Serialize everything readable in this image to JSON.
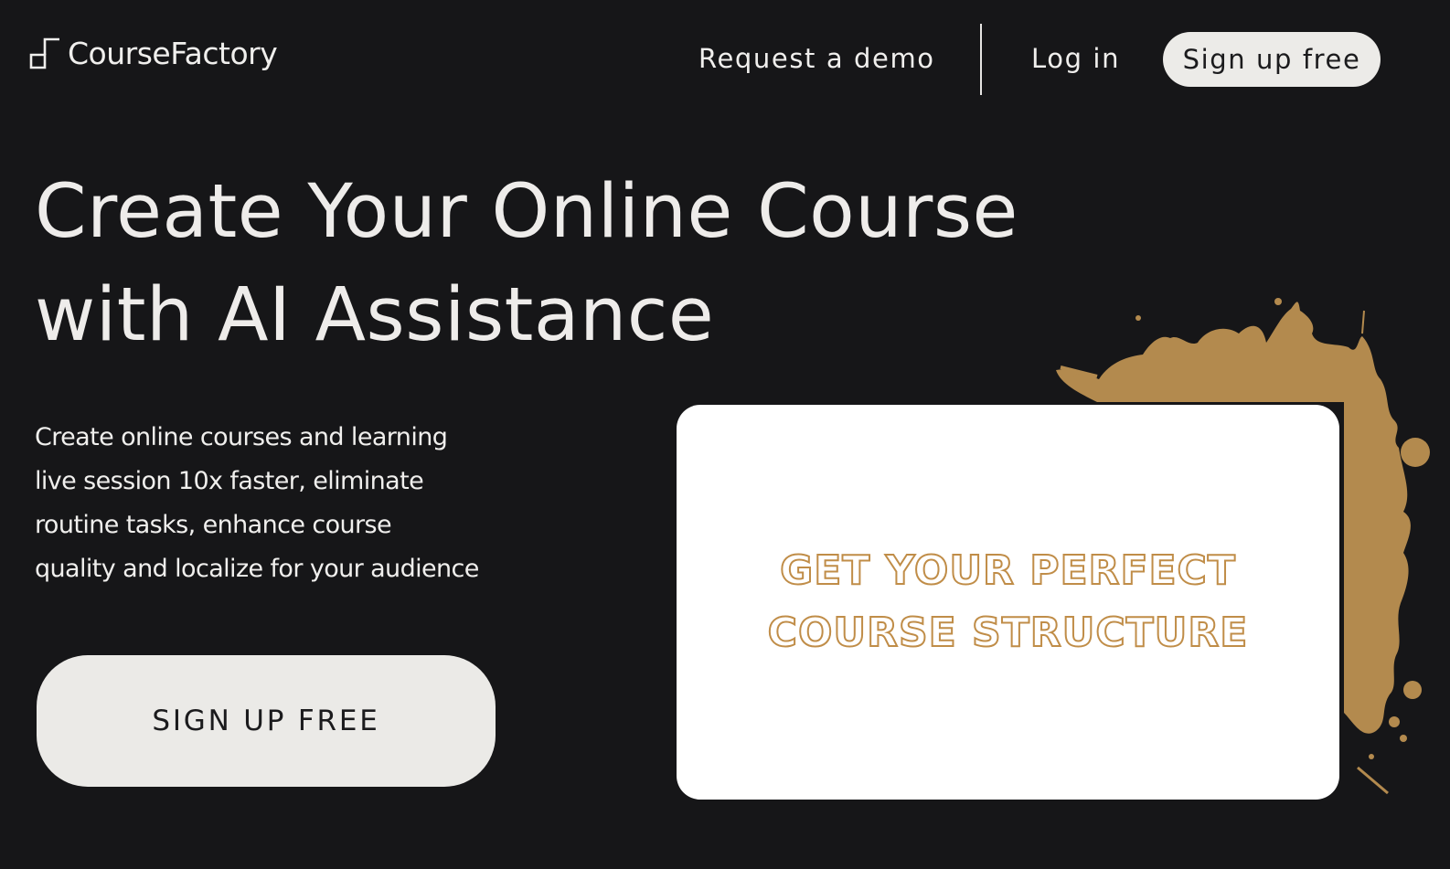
{
  "header": {
    "logo_text": "CourseFactory",
    "nav": {
      "demo_label": "Request a demo",
      "login_label": "Log in",
      "signup_label": "Sign up free"
    }
  },
  "hero": {
    "title_lines": [
      "Create Your Online Course",
      "with AI Assistance"
    ],
    "subtitle_lines": [
      "Create online courses and learning",
      "live session 10x faster, eliminate",
      "routine tasks, enhance course",
      "quality and localize for your audience"
    ],
    "cta_label": "SIGN UP FREE"
  },
  "promo_card": {
    "lines": [
      "GET YOUR PERFECT",
      "COURSE STRUCTURE"
    ]
  },
  "colors": {
    "background": "#161618",
    "text_light": "#eeecea",
    "button_bg": "#ebeae7",
    "accent_gold": "#b38a4e"
  },
  "icons": {
    "logo": "coursefactory-logo-icon",
    "splash": "paint-splash-decoration"
  }
}
